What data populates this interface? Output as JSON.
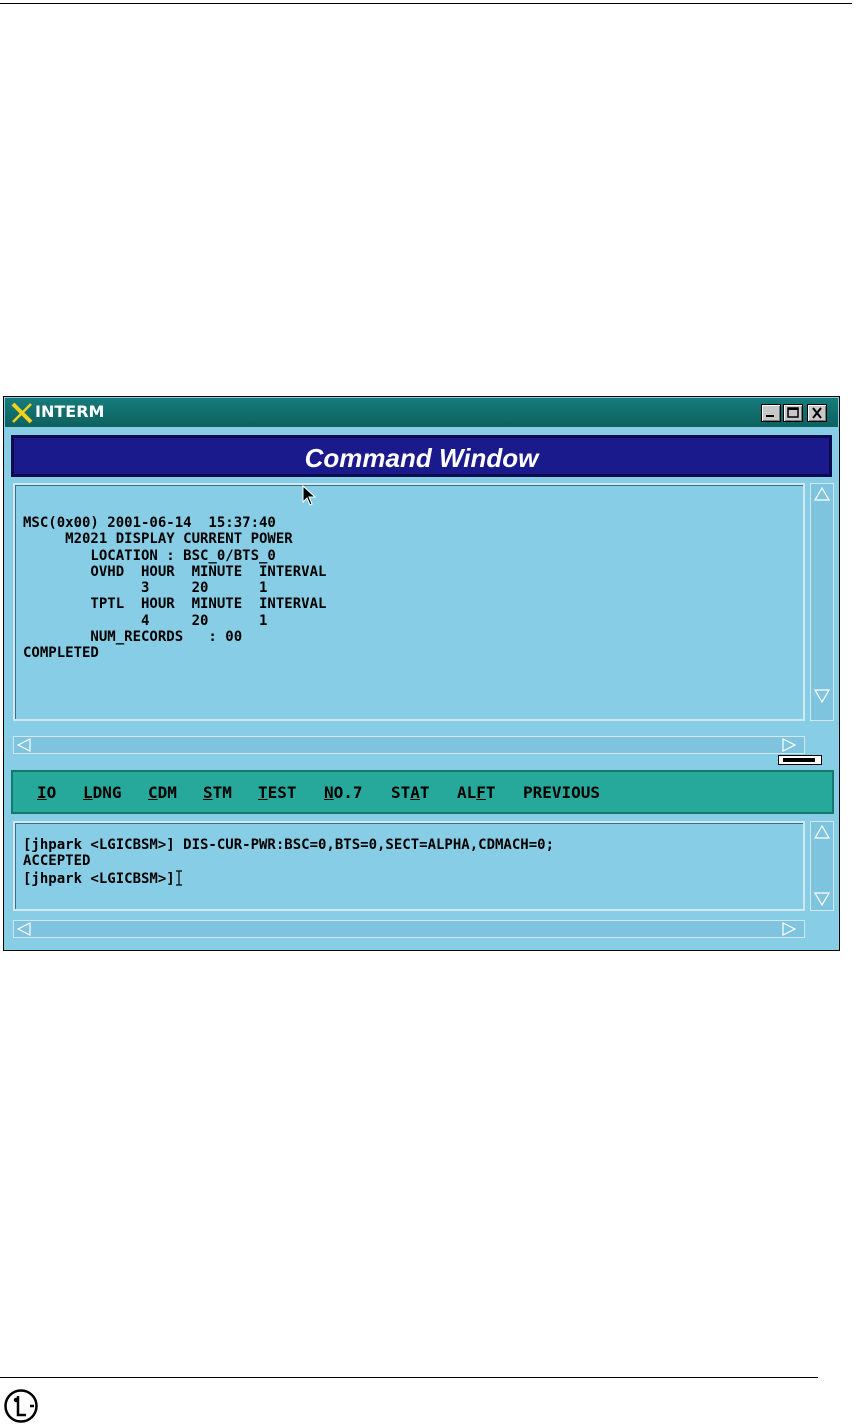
{
  "window": {
    "title": "INTERM",
    "header": "Command Window"
  },
  "output": {
    "lines": [
      "MSC(0x00) 2001-06-14  15:37:40",
      "     M2021 DISPLAY CURRENT POWER",
      "        LOCATION : BSC_0/BTS_0",
      "        OVHD  HOUR  MINUTE  INTERVAL",
      "              3     20      1",
      "        TPTL  HOUR  MINUTE  INTERVAL",
      "              4     20      1",
      "        NUM_RECORDS   : 00",
      "COMPLETED"
    ]
  },
  "menu": {
    "items": [
      {
        "pre": "",
        "u": "I",
        "post": "O"
      },
      {
        "pre": "",
        "u": "L",
        "post": "DNG"
      },
      {
        "pre": "",
        "u": "C",
        "post": "DM"
      },
      {
        "pre": "",
        "u": "S",
        "post": "TM"
      },
      {
        "pre": "",
        "u": "T",
        "post": "EST"
      },
      {
        "pre": "",
        "u": "N",
        "post": "O.7"
      },
      {
        "pre": "ST",
        "u": "A",
        "post": "T"
      },
      {
        "pre": "AL",
        "u": "F",
        "post": "T"
      },
      {
        "pre": "PREVIOUS",
        "u": "",
        "post": ""
      }
    ]
  },
  "input": {
    "lines": [
      "[jhpark <LGICBSM>] DIS-CUR-PWR:BSC=0,BTS=0,SECT=ALPHA,CDMACH=0;",
      "ACCEPTED",
      "[jhpark <LGICBSM>]"
    ]
  },
  "colors": {
    "panel_bg": "#88cde6",
    "title_bar": "#157b7a",
    "header_bg": "#1a1a8c",
    "menu_bg": "#26a99a"
  },
  "icons": {
    "title": "x-logo-icon",
    "logo": "lg-logo-icon",
    "pointer": "mouse-pointer-icon"
  }
}
